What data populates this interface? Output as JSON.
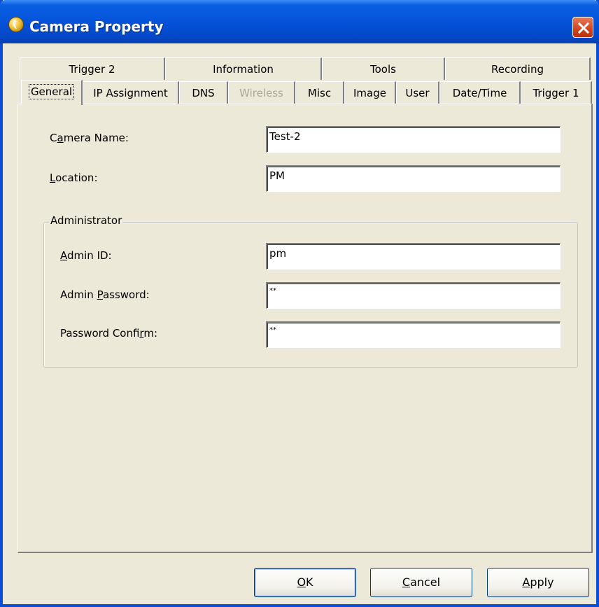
{
  "window": {
    "title": "Camera Property"
  },
  "tabs_row_back": [
    {
      "label": "Trigger 2"
    },
    {
      "label": "Information"
    },
    {
      "label": "Tools"
    },
    {
      "label": "Recording"
    }
  ],
  "tabs_row_front": [
    {
      "label": "General",
      "active": true
    },
    {
      "label": "IP Assignment"
    },
    {
      "label": "DNS"
    },
    {
      "label": "Wireless",
      "disabled": true
    },
    {
      "label": "Misc"
    },
    {
      "label": "Image"
    },
    {
      "label": "User"
    },
    {
      "label": "Date/Time"
    },
    {
      "label": "Trigger 1"
    }
  ],
  "general": {
    "camera_name_label_pre": "C",
    "camera_name_label_ul": "a",
    "camera_name_label_post": "mera Name:",
    "camera_name_value": "Test-2",
    "location_label_ul": "L",
    "location_label_post": "ocation:",
    "location_value": "PM",
    "admin_group_label": "Administrator",
    "admin_id_label_ul": "A",
    "admin_id_label_post": "dmin ID:",
    "admin_id_value": "pm",
    "admin_password_label_pre": "Admin ",
    "admin_password_label_ul": "P",
    "admin_password_label_post": "assword:",
    "admin_password_value": "**",
    "password_confirm_label_pre": "Password Confi",
    "password_confirm_label_ul": "r",
    "password_confirm_label_post": "m:",
    "password_confirm_value": "**"
  },
  "buttons": {
    "ok_ul": "O",
    "ok_post": "K",
    "cancel_ul": "C",
    "cancel_post": "ancel",
    "apply_ul": "A",
    "apply_post": "pply"
  },
  "colors": {
    "titlebar": "#0555dc",
    "face": "#ece9d8",
    "close": "#d3441c"
  }
}
